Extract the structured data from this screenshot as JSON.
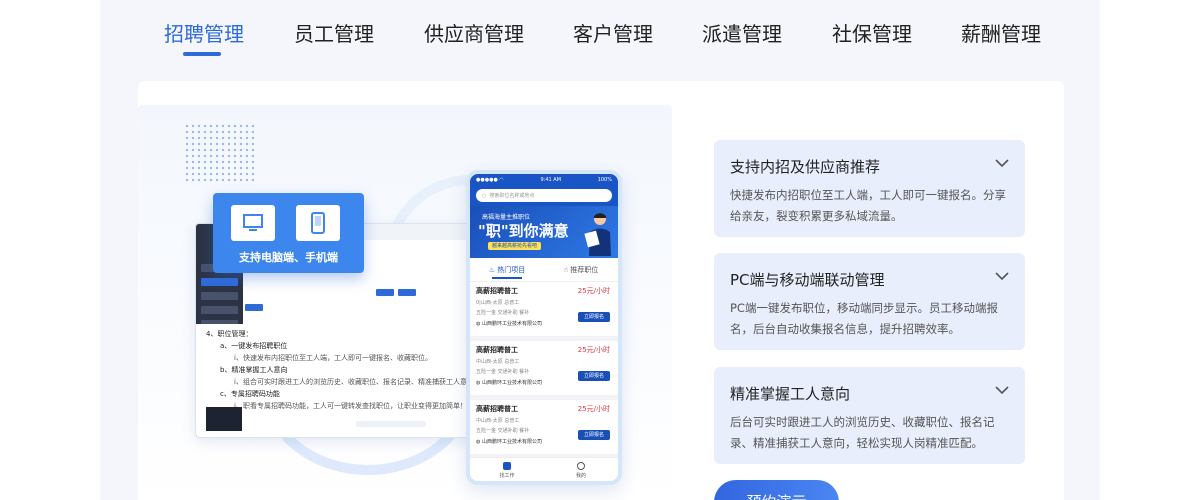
{
  "tabs": [
    {
      "label": "招聘管理",
      "active": true
    },
    {
      "label": "员工管理"
    },
    {
      "label": "供应商管理"
    },
    {
      "label": "客户管理"
    },
    {
      "label": "派遣管理"
    },
    {
      "label": "社保管理"
    },
    {
      "label": "薪酬管理"
    }
  ],
  "illustration": {
    "device_label": "支持电脑端、手机端",
    "desktop_doc": {
      "heading": "4、职位管理：",
      "lines": [
        "a、一键发布招聘职位",
        "i、快速发布内招职位至工人端，工人即可一键报名、收藏职位。",
        "b、精准掌握工人意向",
        "i、组合可实时跟进工人的浏览历史、收藏职位、报名记录、精准捕获工人意向。",
        "c、专属招聘码功能",
        "i、职看专属招聘码功能，工人可一键转发查找职位，让职业变得更加简单！"
      ]
    },
    "phone": {
      "time": "9:41 AM",
      "battery": "100%",
      "search_placeholder": "搜索职位名称或地点",
      "banner_top": "高福海量主推职位",
      "banner_main": "\"职\"到你满意",
      "banner_sub": "越来越高薪抢先看吧",
      "tab_hot": "热门项目",
      "tab_recommend": "推荐职位",
      "jobs": [
        {
          "title": "高薪招聘普工",
          "salary": "25元/小时",
          "meta": "0|山西-太原    总普工",
          "tags": "五险一金    交通补助    餐补",
          "company": "山西鹏环工业技术有限公司",
          "apply": "立即报名"
        },
        {
          "title": "高薪招聘普工",
          "salary": "25元/小时",
          "meta": "中山西-太原    总普工",
          "tags": "五险一金    交通补助    餐补",
          "company": "山西鹏环工业技术有限公司",
          "apply": "立即报名"
        },
        {
          "title": "高薪招聘普工",
          "salary": "25元/小时",
          "meta": "中山西-太原    总普工",
          "tags": "五险一金    交通补助    餐补",
          "company": "山西鹏环工业技术有限公司",
          "apply": "立即报名"
        }
      ],
      "nav_work": "找工作",
      "nav_mine": "我的"
    }
  },
  "features": [
    {
      "title": "支持内招及供应商推荐",
      "desc": "快捷发布内招职位至工人端，工人即可一键报名。分享给亲友，裂变积累更多私域流量。"
    },
    {
      "title": "PC端与移动端联动管理",
      "desc": "PC端一键发布职位，移动端同步显示。员工移动端报名，后台自动收集报名信息，提升招聘效率。"
    },
    {
      "title": "精准掌握工人意向",
      "desc": "后台可实时跟进工人的浏览历史、收藏职位、报名记录、精准捕获工人意向，轻松实现人岗精准匹配。"
    }
  ],
  "demo_button": "预约演示",
  "colors": {
    "accent": "#2f6bd8",
    "panel": "#e8eefc",
    "salary": "#e0383e"
  }
}
